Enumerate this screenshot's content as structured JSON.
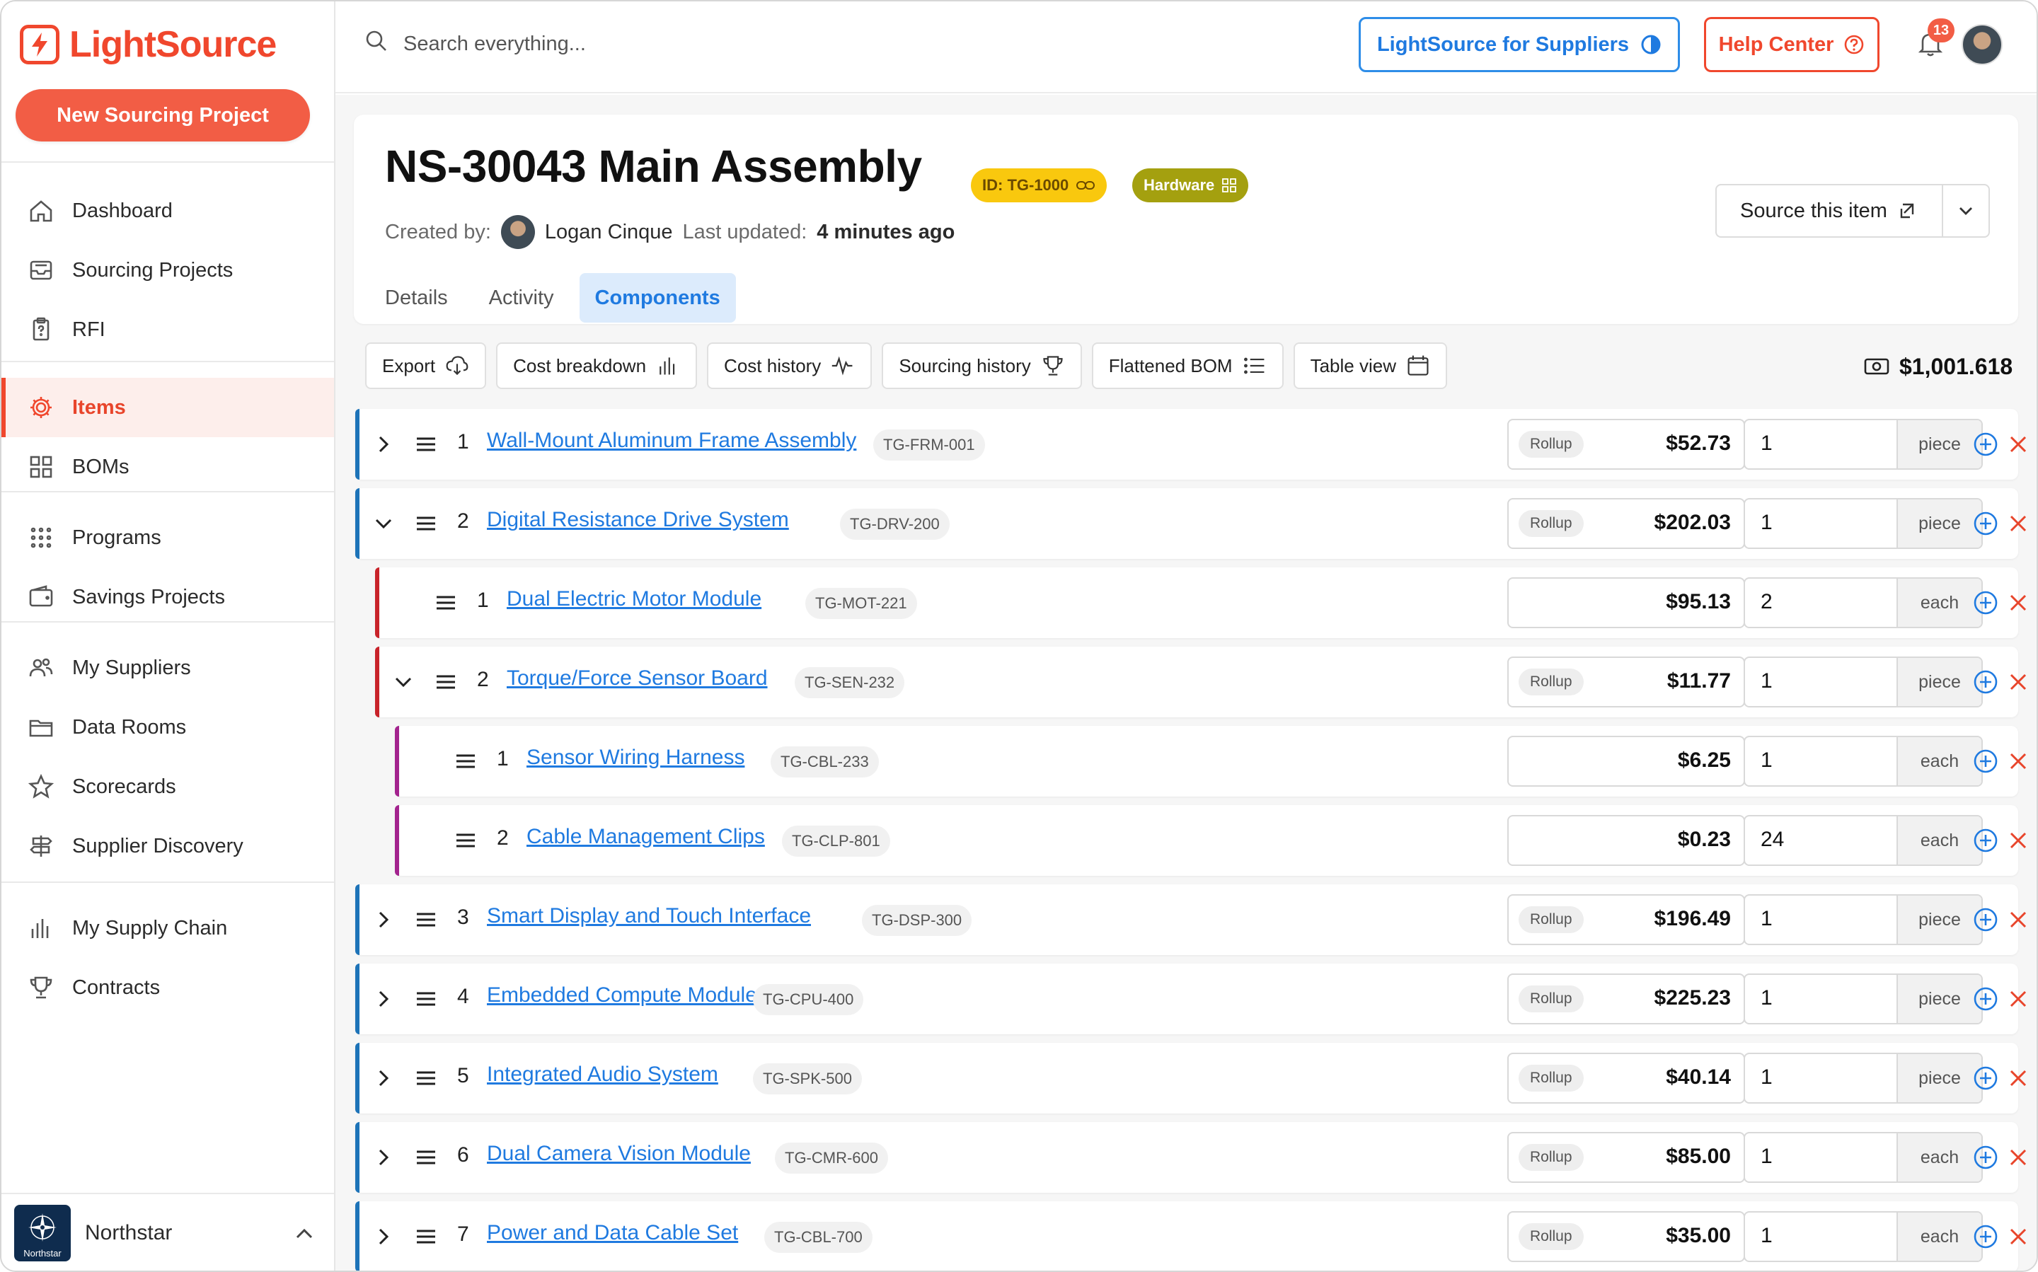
{
  "app": {
    "name": "LightSource",
    "new_project_label": "New Sourcing Project",
    "accent": "#f0472d"
  },
  "nav": {
    "groups": [
      [
        {
          "label": "Dashboard",
          "icon": "home-icon"
        },
        {
          "label": "Sourcing Projects",
          "icon": "inbox-icon"
        },
        {
          "label": "RFI",
          "icon": "clipboard-icon"
        }
      ],
      [
        {
          "label": "Items",
          "icon": "gear-icon",
          "active": true
        },
        {
          "label": "BOMs",
          "icon": "grid-icon"
        }
      ],
      [
        {
          "label": "Programs",
          "icon": "dots-grid-icon"
        },
        {
          "label": "Savings Projects",
          "icon": "wallet-icon"
        }
      ],
      [
        {
          "label": "My Suppliers",
          "icon": "users-icon"
        },
        {
          "label": "Data Rooms",
          "icon": "folder-icon"
        },
        {
          "label": "Scorecards",
          "icon": "star-icon"
        },
        {
          "label": "Supplier Discovery",
          "icon": "signpost-icon"
        }
      ],
      [
        {
          "label": "My Supply Chain",
          "icon": "bar-chart-icon"
        },
        {
          "label": "Contracts",
          "icon": "trophy-icon"
        }
      ]
    ]
  },
  "org": {
    "name": "Northstar",
    "logo_text": "Northstar"
  },
  "topbar": {
    "search_placeholder": "Search everything...",
    "supplier_label": "LightSource for Suppliers",
    "help_label": "Help Center",
    "notification_count": "13"
  },
  "item": {
    "title": "NS-30043 Main Assembly",
    "id_pill": "ID: TG-1000",
    "category_pill": "Hardware",
    "created_by_label": "Created by:",
    "creator": "Logan Cinque",
    "updated_label": "Last updated:",
    "updated_value": "4 minutes ago",
    "tabs": [
      "Details",
      "Activity",
      "Components"
    ],
    "active_tab": "Components",
    "source_label": "Source this item"
  },
  "toolbar": {
    "buttons": [
      {
        "label": "Export",
        "icon": "cloud-download-icon"
      },
      {
        "label": "Cost breakdown",
        "icon": "bar-chart-icon"
      },
      {
        "label": "Cost history",
        "icon": "activity-icon"
      },
      {
        "label": "Sourcing history",
        "icon": "trophy-icon"
      },
      {
        "label": "Flattened BOM",
        "icon": "list-icon"
      },
      {
        "label": "Table view",
        "icon": "calendar-icon"
      }
    ],
    "total": "$1,001.618"
  },
  "bom": {
    "rollup_label": "Rollup",
    "rows": [
      {
        "level": 0,
        "expand": "collapsed",
        "index": "1",
        "name": "Wall-Mount Aluminum Frame Assembly",
        "code": "TG-FRM-001",
        "rollup": true,
        "cost": "$52.73",
        "qty": "1",
        "unit": "piece"
      },
      {
        "level": 0,
        "expand": "expanded",
        "index": "2",
        "name": "Digital Resistance Drive System",
        "code": "TG-DRV-200",
        "rollup": true,
        "cost": "$202.03",
        "qty": "1",
        "unit": "piece"
      },
      {
        "level": 1,
        "expand": "none",
        "index": "1",
        "name": "Dual Electric Motor Module",
        "code": "TG-MOT-221",
        "rollup": false,
        "cost": "$95.13",
        "qty": "2",
        "unit": "each"
      },
      {
        "level": 1,
        "expand": "expanded",
        "index": "2",
        "name": "Torque/Force Sensor Board",
        "code": "TG-SEN-232",
        "rollup": true,
        "cost": "$11.77",
        "qty": "1",
        "unit": "piece"
      },
      {
        "level": 2,
        "expand": "none",
        "index": "1",
        "name": "Sensor Wiring Harness",
        "code": "TG-CBL-233",
        "rollup": false,
        "cost": "$6.25",
        "qty": "1",
        "unit": "each"
      },
      {
        "level": 2,
        "expand": "none",
        "index": "2",
        "name": "Cable Management Clips",
        "code": "TG-CLP-801",
        "rollup": false,
        "cost": "$0.23",
        "qty": "24",
        "unit": "each"
      },
      {
        "level": 0,
        "expand": "collapsed",
        "index": "3",
        "name": "Smart Display and Touch Interface",
        "code": "TG-DSP-300",
        "rollup": true,
        "cost": "$196.49",
        "qty": "1",
        "unit": "piece"
      },
      {
        "level": 0,
        "expand": "collapsed",
        "index": "4",
        "name": "Embedded Compute Module",
        "code": "TG-CPU-400",
        "rollup": true,
        "cost": "$225.23",
        "qty": "1",
        "unit": "piece"
      },
      {
        "level": 0,
        "expand": "collapsed",
        "index": "5",
        "name": "Integrated Audio System",
        "code": "TG-SPK-500",
        "rollup": true,
        "cost": "$40.14",
        "qty": "1",
        "unit": "piece"
      },
      {
        "level": 0,
        "expand": "collapsed",
        "index": "6",
        "name": "Dual Camera Vision Module",
        "code": "TG-CMR-600",
        "rollup": true,
        "cost": "$85.00",
        "qty": "1",
        "unit": "each"
      },
      {
        "level": 0,
        "expand": "collapsed",
        "index": "7",
        "name": "Power and Data Cable Set",
        "code": "TG-CBL-700",
        "rollup": true,
        "cost": "$35.00",
        "qty": "1",
        "unit": "each"
      }
    ]
  }
}
